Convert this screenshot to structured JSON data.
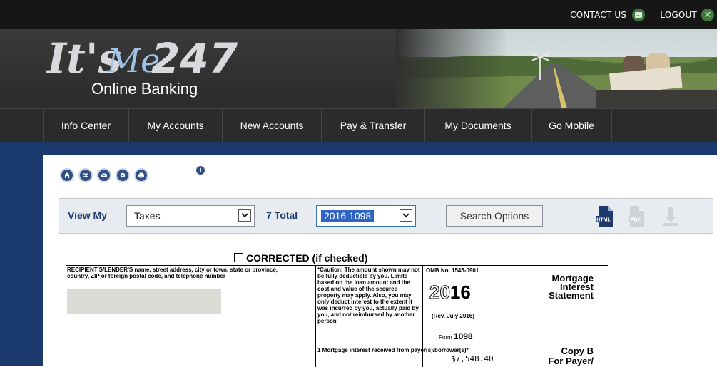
{
  "topbar": {
    "contact_label": "CONTACT US",
    "logout_label": "LOGOUT"
  },
  "brand": {
    "logo_its": "It's",
    "logo_me": "Me",
    "logo_num": "247",
    "logo_sub": "Online Banking"
  },
  "nav": {
    "items": [
      "Info Center",
      "My Accounts",
      "New Accounts",
      "Pay & Transfer",
      "My Documents",
      "Go Mobile"
    ]
  },
  "toolbar": {
    "view_label": "View My",
    "view_value": "Taxes",
    "total_label": "7 Total",
    "doc_value": "2016 1098",
    "search_label": "Search Options"
  },
  "form": {
    "corrected": "CORRECTED (if checked)",
    "recipient_label": "RECIPIENT'S/LENDER'S name, street address, city or town, state or province, country, ZIP or foreign postal code, and telephone number",
    "caution": "*Caution: The amount shown may not be fully deductible by you. Limits based on the loan amount and the cost and value of the secured property may apply. Also, you may only deduct interest to the extent it was incurred by you, actually paid by you, and not reimbursed by another person",
    "omb": "OMB No. 1545-0901",
    "year_outline": "20",
    "year_bold": "16",
    "rev": "(Rev. July 2016)",
    "form_prefix": "Form",
    "form_num": "1098",
    "title": "Mortgage Interest Statement",
    "box1_label": "1 Mortgage interest received from payer(s)/borrower(s)*",
    "box1_value": "$7,548.40",
    "copy_b": "Copy B",
    "for_payer": "For Payer/"
  },
  "colors": {
    "brand_blue": "#1a3a6d",
    "icon_blue": "#2f4f87",
    "accent_green": "#3d7a3b"
  }
}
